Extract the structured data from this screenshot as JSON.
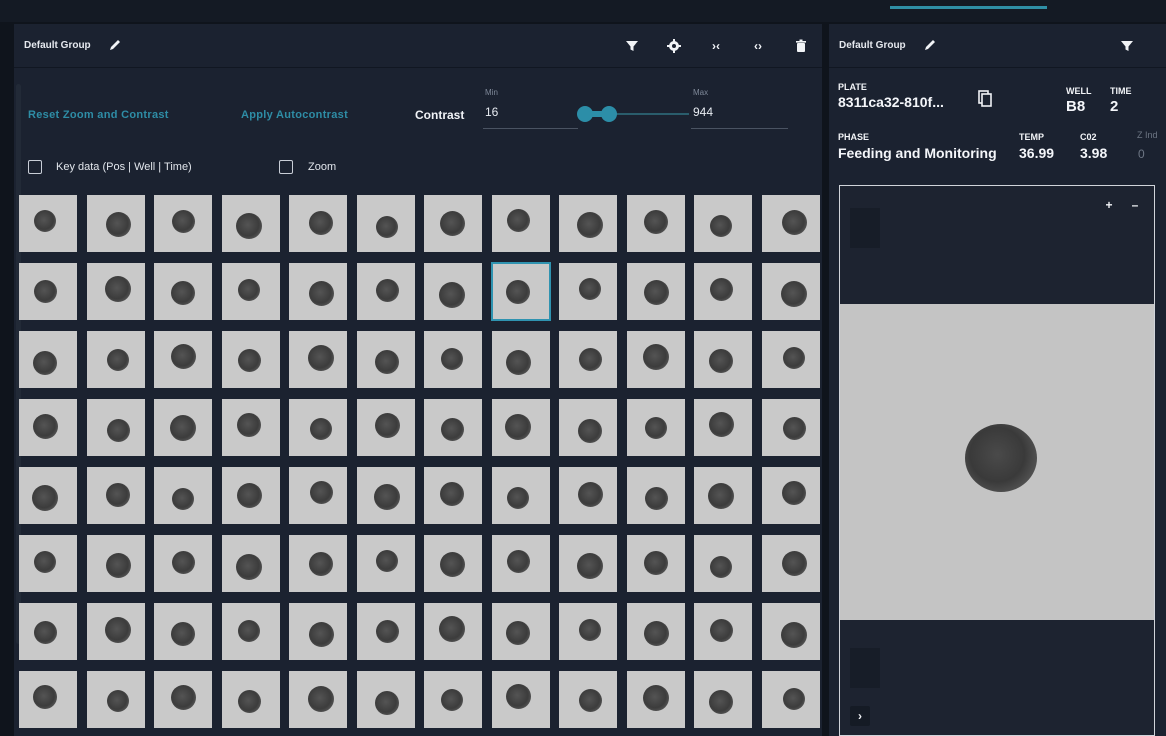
{
  "left_panel": {
    "group_name": "Default Group",
    "icons": [
      "pencil-icon",
      "filter-icon",
      "gear-icon",
      "collapse-icon",
      "expand-icon",
      "trash-icon"
    ],
    "collapse_glyph": "›‹",
    "expand_glyph": "‹›",
    "reset_link": "Reset Zoom and Contrast",
    "autocontrast_link": "Apply Autocontrast",
    "contrast_label": "Contrast",
    "min_caption": "Min",
    "min_value": "16",
    "max_caption": "Max",
    "max_value": "944",
    "key_data_label": "Key data (Pos | Well | Time)",
    "zoom_label": "Zoom",
    "grid": {
      "rows": 8,
      "cols": 12,
      "selected_row": 1,
      "selected_col": 7
    }
  },
  "right_panel": {
    "group_name": "Default Group",
    "plate_caption": "PLATE",
    "plate_value": "8311ca32-810f...",
    "well_caption": "WELL",
    "well_value": "B8",
    "time_caption": "TIME",
    "time_value": "2",
    "phase_caption": "PHASE",
    "phase_value": "Feeding and Monitoring",
    "temp_caption": "TEMP",
    "temp_value": "36.99",
    "co2_caption": "C02",
    "co2_value": "3.98",
    "zindex_caption": "Z Ind",
    "zindex_value": "0",
    "zoom_in": "+",
    "zoom_out": "–",
    "expand": "›"
  },
  "colors": {
    "accent": "#2f8fa6",
    "panel": "#1b2230",
    "background": "#0f141c"
  }
}
